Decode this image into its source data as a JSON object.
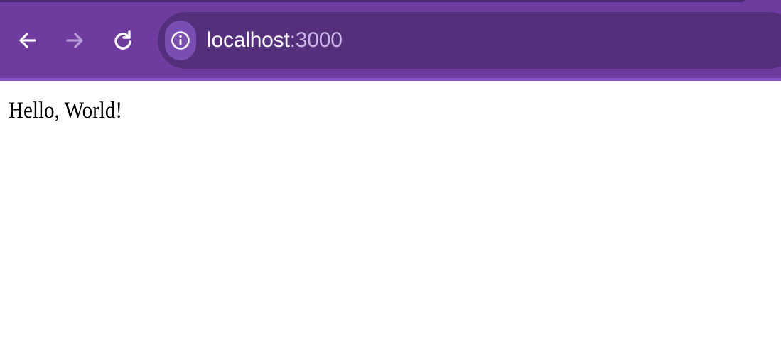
{
  "browser": {
    "address_bar": {
      "host": "localhost",
      "port": ":3000"
    },
    "icons": {
      "back": "back-arrow-icon",
      "forward": "forward-arrow-icon",
      "reload": "reload-icon",
      "site_info": "info-icon"
    },
    "colors": {
      "toolbar": "#6e3c9e",
      "omnibox": "#54307c",
      "site_info_chip": "#7a4db0",
      "forward_disabled": "#b59ad6"
    }
  },
  "page": {
    "body_text": "Hello, World!"
  }
}
